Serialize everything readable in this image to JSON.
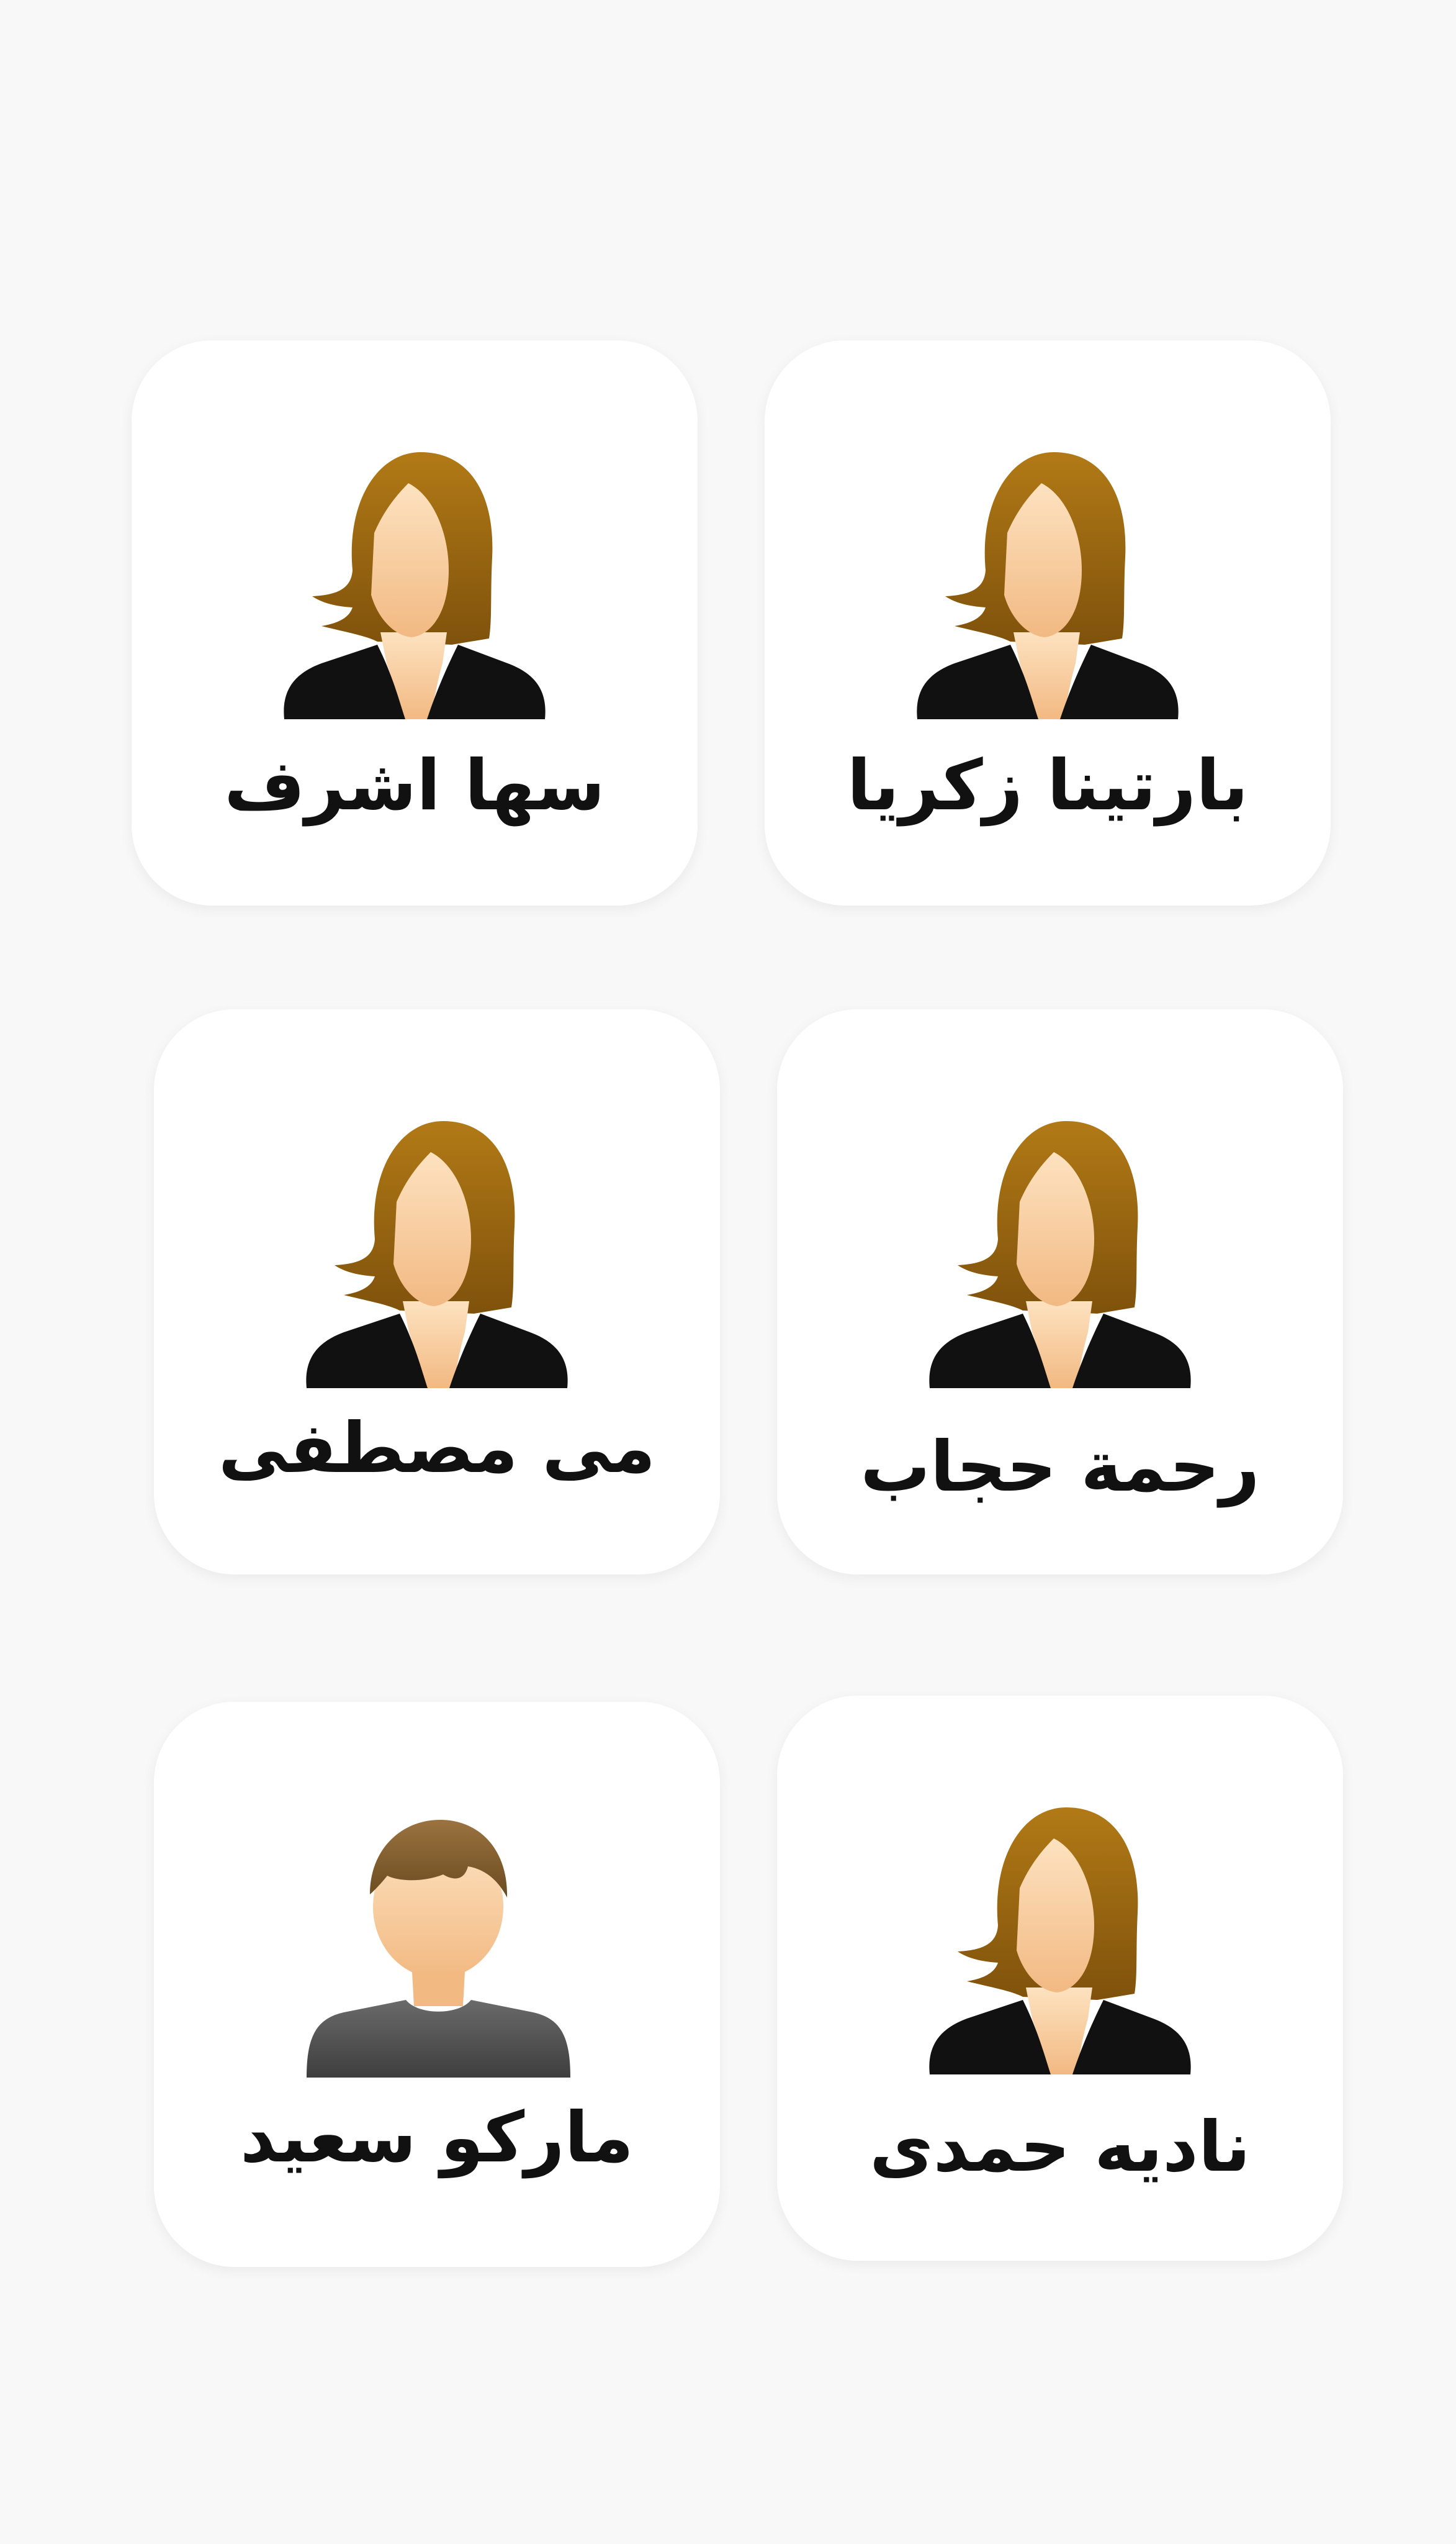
{
  "contacts": [
    {
      "name": "بارتينا زكريا",
      "avatar": "female-avatar-icon"
    },
    {
      "name": "سها اشرف",
      "avatar": "female-avatar-icon"
    },
    {
      "name": "رحمة حجاب",
      "avatar": "female-avatar-icon"
    },
    {
      "name": "مى مصطفى",
      "avatar": "female-avatar-icon"
    },
    {
      "name": "ناديه حمدى",
      "avatar": "female-avatar-icon"
    },
    {
      "name": "ماركو سعيد",
      "avatar": "male-avatar-icon"
    }
  ]
}
